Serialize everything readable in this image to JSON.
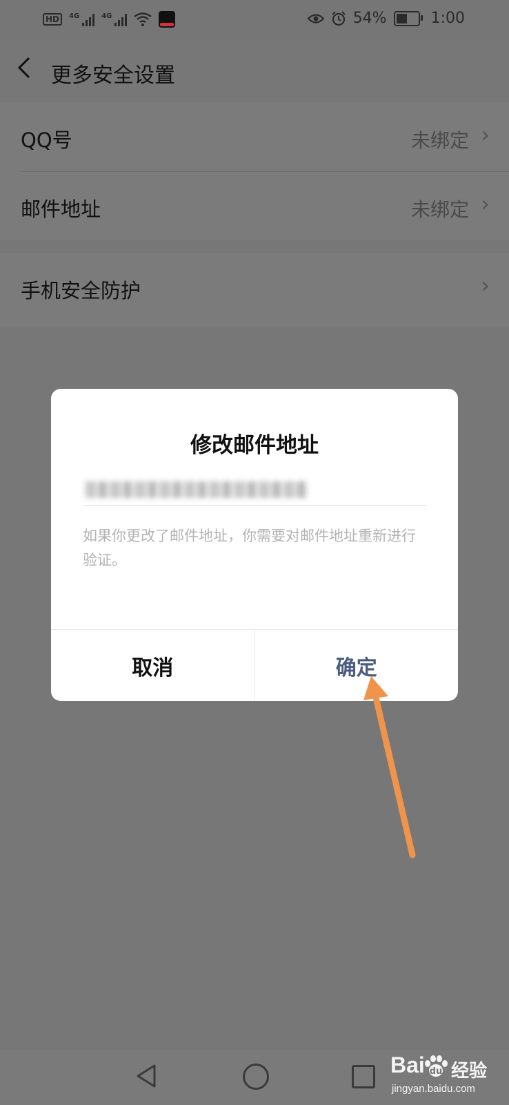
{
  "status_bar": {
    "hd_label": "HD",
    "network_1": "4G",
    "network_2": "4G",
    "battery": "54%",
    "battery_level": 0.54,
    "time": "1:00"
  },
  "header": {
    "title": "更多安全设置"
  },
  "settings": {
    "group1": [
      {
        "label": "QQ号",
        "value": "未绑定"
      },
      {
        "label": "邮件地址",
        "value": "未绑定"
      }
    ],
    "group2": [
      {
        "label": "手机安全防护",
        "value": ""
      }
    ]
  },
  "dialog": {
    "title": "修改邮件地址",
    "hint": "如果你更改了邮件地址，你需要对邮件地址重新进行验证。",
    "cancel_label": "取消",
    "confirm_label": "确定"
  },
  "watermark": {
    "logo": "Bai",
    "logo_suffix": "经验",
    "url": "jingyan.baidu.com"
  },
  "colors": {
    "overlay": "#777777",
    "confirm": "#4a5c80",
    "arrow": "#f0944b"
  }
}
